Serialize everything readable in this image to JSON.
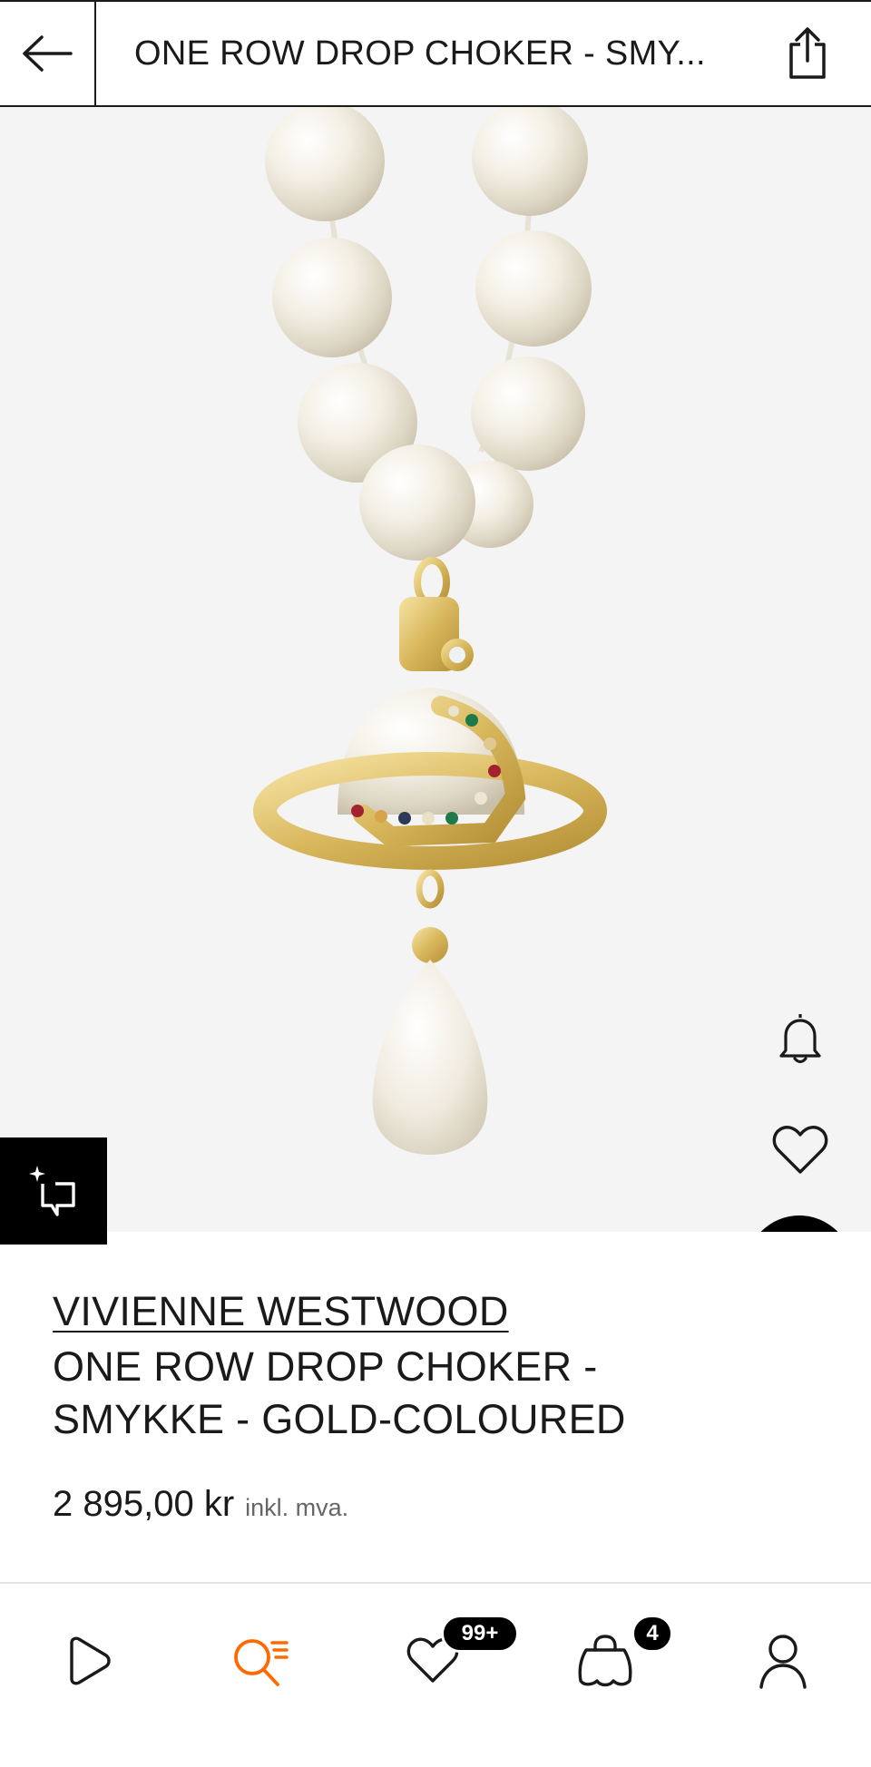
{
  "header": {
    "title": "ONE ROW DROP CHOKER - SMY...",
    "back_icon": "arrow-left-icon",
    "share_icon": "share-icon"
  },
  "product": {
    "brand": "VIVIENNE WESTWOOD",
    "name": "ONE ROW DROP CHOKER - SMYKKE - GOLD-COLOURED",
    "price": "2 895,00 kr",
    "tax_note": "inkl. mva."
  },
  "image_actions": {
    "similar_icon": "sparkle-crop-icon",
    "notify_icon": "bell-icon",
    "wishlist_icon": "heart-icon",
    "add_to_bag_icon": "shopping-bag-icon"
  },
  "bottom_nav": {
    "items": [
      {
        "name": "home",
        "icon": "play-outline-icon"
      },
      {
        "name": "search",
        "icon": "search-list-icon",
        "color": "#ff6900"
      },
      {
        "name": "wishlist",
        "icon": "heart-icon",
        "badge": "99+"
      },
      {
        "name": "bag",
        "icon": "shopping-bag-icon",
        "badge": "4"
      },
      {
        "name": "profile",
        "icon": "user-icon"
      }
    ]
  },
  "colors": {
    "accent": "#ff6900",
    "text": "#1a1a1a",
    "image_bg": "#f4f4f4"
  }
}
